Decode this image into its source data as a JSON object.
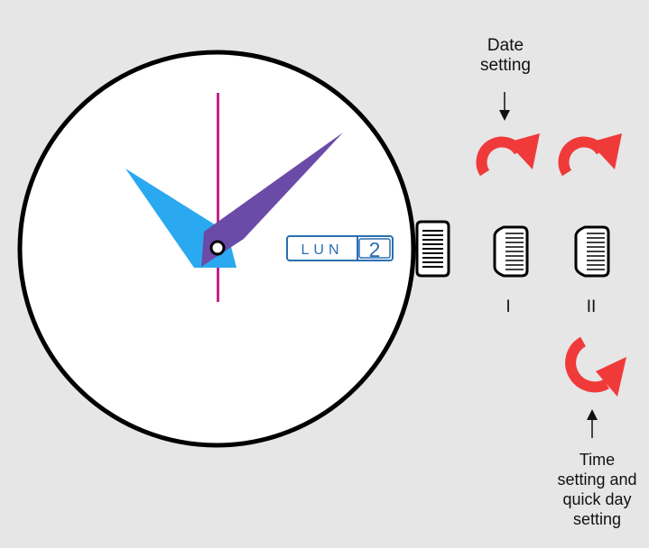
{
  "dial": {
    "day_text": "LUN",
    "date_text": "2"
  },
  "labels": {
    "date_setting_line1": "Date",
    "date_setting_line2": "setting",
    "position_one": "I",
    "position_two": "II",
    "time_setting_lines": [
      "Time",
      "setting and",
      "quick day",
      "setting"
    ]
  },
  "colors": {
    "background": "#e6e6e6",
    "dial_face": "#ffffff",
    "case_outline": "#000000",
    "hour_hand": "#2aa8f0",
    "minute_hand": "#6b4ba8",
    "seconds_hand": "#c2238f",
    "date_window": "#2a6fb0",
    "rotation_arrow": "#f03a3a"
  },
  "icons": [
    "crown-icon",
    "clockwise-rotation-arrow-icon",
    "counterclockwise-rotation-arrow-icon",
    "down-arrow-icon",
    "up-arrow-icon"
  ]
}
